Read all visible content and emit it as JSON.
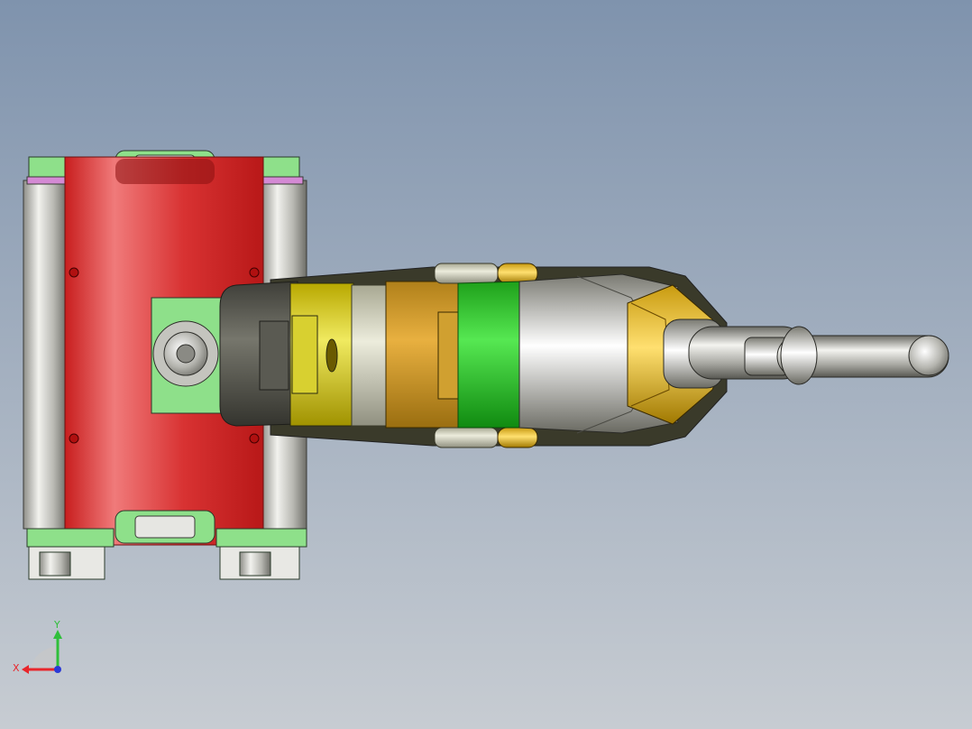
{
  "viewport": {
    "background_top": "#7f93ad",
    "background_bottom": "#c7ccd2"
  },
  "model": {
    "base_color": "#d42a2a",
    "roller_color": "#c9c9c4",
    "bracket_color": "#8ee08a",
    "accent_purple": "#d48ad4",
    "segment_colors": [
      "#5b5b52",
      "#e8e04a",
      "#dcdcc6",
      "#e0a83a",
      "#3ed63a",
      "#d9d9d0",
      "#e8b830",
      "#cfcfcf"
    ]
  },
  "triad": {
    "x_label": "X",
    "y_label": "Y",
    "x_color": "#e8262b",
    "y_color": "#2fbf3a",
    "z_color": "#2a3ad6"
  }
}
